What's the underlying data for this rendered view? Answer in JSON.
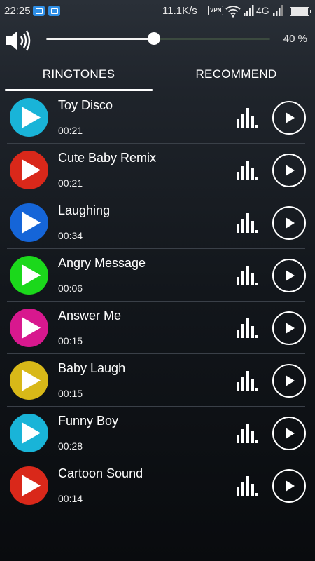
{
  "status_bar": {
    "time": "22:25",
    "net_speed": "11.1K/s",
    "vpn": "VPN",
    "network": "4G",
    "icons": [
      "message-icon",
      "screenshot-icon",
      "vpn-icon",
      "wifi-icon",
      "signal-icon",
      "battery-icon"
    ]
  },
  "volume": {
    "level": 0.4,
    "label": "40 %",
    "icon": "speaker-icon"
  },
  "tabs": [
    {
      "label": "RINGTONES",
      "active": true
    },
    {
      "label": "RECOMMEND",
      "active": false
    }
  ],
  "ringtones": [
    {
      "title": "Toy Disco",
      "duration": "00:21",
      "color": "#19b4d8"
    },
    {
      "title": "Cute Baby Remix",
      "duration": "00:21",
      "color": "#d9281a"
    },
    {
      "title": "Laughing",
      "duration": "00:34",
      "color": "#1565d8"
    },
    {
      "title": "Angry Message",
      "duration": "00:06",
      "color": "#1bd81b"
    },
    {
      "title": "Answer Me",
      "duration": "00:15",
      "color": "#d8188e"
    },
    {
      "title": "Baby Laugh",
      "duration": "00:15",
      "color": "#d8b818"
    },
    {
      "title": "Funny Boy",
      "duration": "00:28",
      "color": "#19b4d8"
    },
    {
      "title": "Cartoon Sound",
      "duration": "00:14",
      "color": "#d9281a"
    }
  ],
  "colors": {
    "accent": "#ffffff",
    "divider": "#3a4048",
    "background": "#1f242b"
  }
}
